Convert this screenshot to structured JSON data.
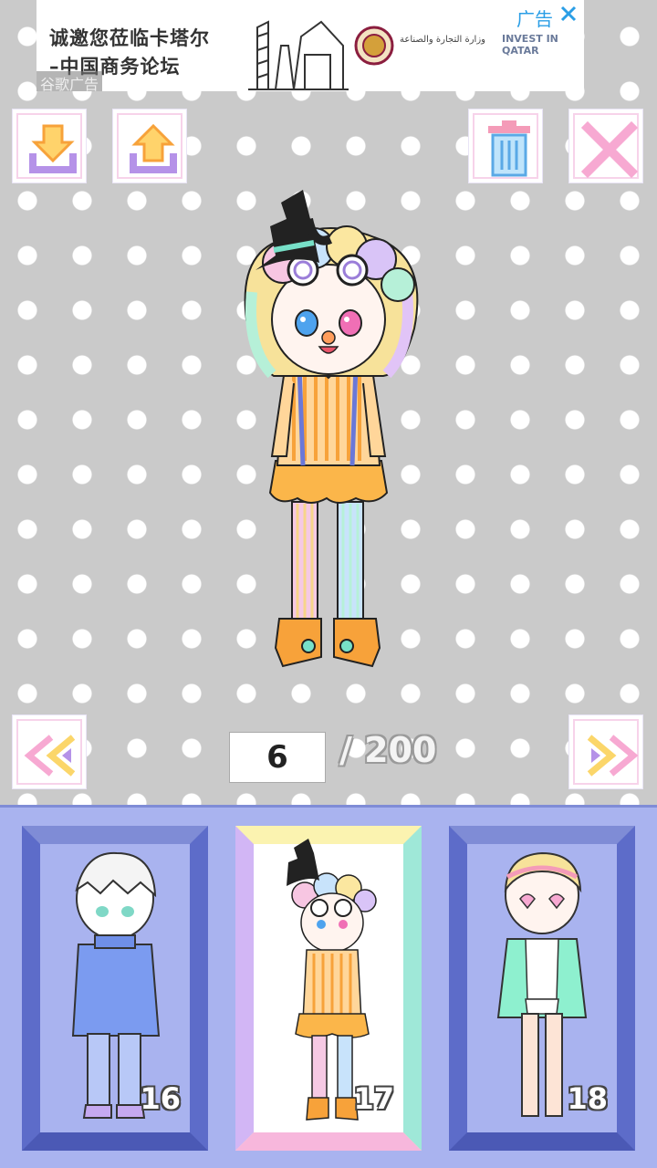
{
  "ad": {
    "line1": "诚邀您莅临卡塔尔",
    "line2": "–中国商务论坛",
    "tag": "广告",
    "source_label": "谷歌广告",
    "arabic_text": "وزارة التجارة والصناعة",
    "invest_text": "INVEST IN QATAR"
  },
  "toolbar": {
    "download_icon": "download-icon",
    "upload_icon": "upload-icon",
    "trash_icon": "trash-icon",
    "close_icon": "close-x-icon"
  },
  "navigation": {
    "prev_icon": "double-chevron-left-icon",
    "next_icon": "double-chevron-right-icon",
    "current": "6",
    "total": "/ 200"
  },
  "slots": [
    {
      "number": "16",
      "character": "white-haired boy in blue sweater"
    },
    {
      "number": "17",
      "character": "pastel rainbow-haired girl with witch hat",
      "selected": true
    },
    {
      "number": "18",
      "character": "pastel girl with heart glasses in mint jacket"
    }
  ],
  "colors": {
    "background": "#cacaca",
    "panel": "#a9b3ef",
    "panel_border": "#7f8cd6",
    "accent_orange": "#f7a23a",
    "accent_purple": "#b592e8"
  }
}
